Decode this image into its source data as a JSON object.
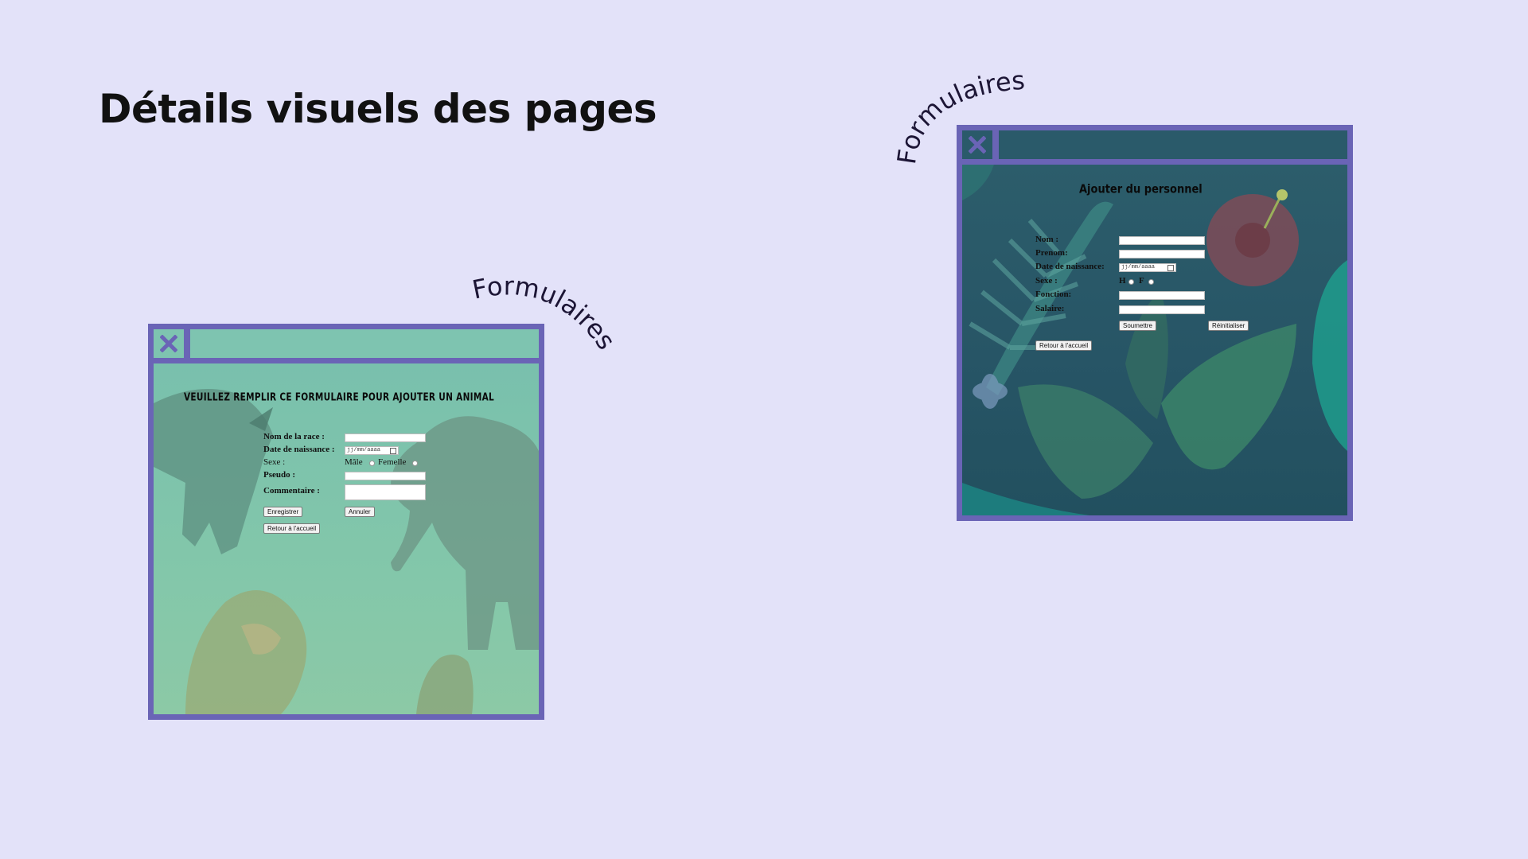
{
  "slide": {
    "title": "Détails visuels des pages",
    "curve_label_left": "Formulaires",
    "curve_label_right": "Formulaires"
  },
  "colors": {
    "background": "#e3e2f9",
    "frame": "#6a64b6",
    "animal_bar": "#7ec4b0",
    "staff_bar": "#2a5a6a"
  },
  "animal_form": {
    "close_icon": "close-icon",
    "heading": "VEUILLEZ REMPLIR CE FORMULAIRE POUR AJOUTER UN ANIMAL",
    "labels": {
      "race": "Nom de la race :",
      "birth": "Date de naissance :",
      "sex": "Sexe :",
      "pseudo": "Pseudo :",
      "comment": "Commentaire :"
    },
    "date_placeholder": "jj/mm/aaaa",
    "sex_options": [
      "Mâle",
      "Femelle"
    ],
    "buttons": {
      "save": "Enregistrer",
      "cancel": "Annuler",
      "home": "Retour à l'accueil"
    }
  },
  "staff_form": {
    "close_icon": "close-icon",
    "heading": "Ajouter du personnel",
    "labels": {
      "name": "Nom :",
      "firstname": "Prenom:",
      "birth": "Date de naissance:",
      "sex": "Sexe :",
      "function": "Fonction:",
      "salary": "Salaire:"
    },
    "date_placeholder": "jj/mm/aaaa",
    "sex_options": [
      "H",
      "F"
    ],
    "buttons": {
      "submit": "Soumettre",
      "reset": "Réinitialiser",
      "home": "Retour à l'accueil"
    }
  }
}
